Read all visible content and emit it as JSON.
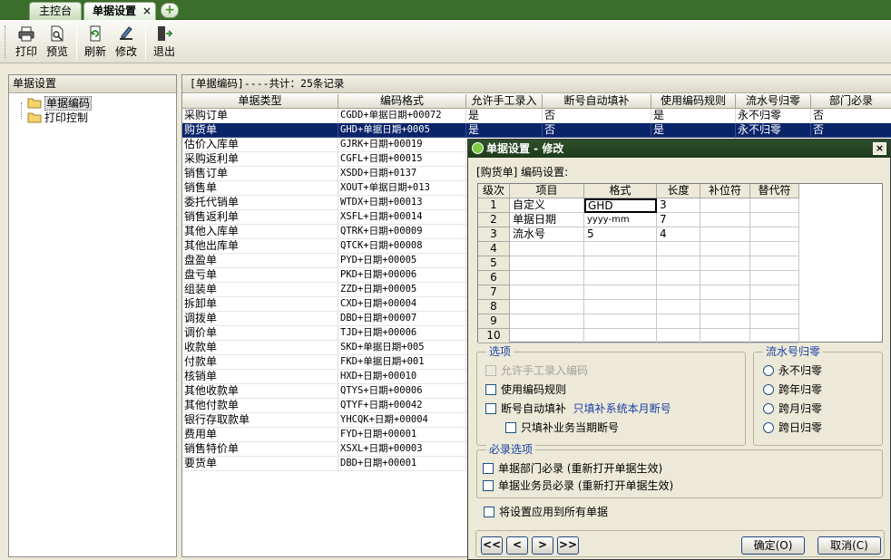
{
  "tabs": {
    "home": "主控台",
    "current": "单据设置",
    "close": "×",
    "add": "+"
  },
  "toolbar": {
    "print": "打印",
    "preview": "预览",
    "refresh": "刷新",
    "edit": "修改",
    "exit": "退出"
  },
  "left": {
    "title": "单据设置",
    "items": [
      {
        "label": "单据编码"
      },
      {
        "label": "打印控制"
      }
    ]
  },
  "main": {
    "title": "[单据编码]----共计：25条记录",
    "headers": [
      "单据类型",
      "编码格式",
      "允许手工录入",
      "断号自动填补",
      "使用编码规则",
      "流水号归零",
      "部门必录"
    ],
    "rows": [
      [
        "采购订单",
        "CGDD+单据日期+00072",
        "是",
        "否",
        "是",
        "永不归零",
        "否"
      ],
      [
        "购货单",
        "GHD+单据日期+0005",
        "是",
        "否",
        "是",
        "永不归零",
        "否"
      ],
      [
        "估价入库单",
        "GJRK+日期+00019",
        "",
        "",
        "",
        "",
        ""
      ],
      [
        "采购返利单",
        "CGFL+日期+00015",
        "",
        "",
        "",
        "",
        ""
      ],
      [
        "销售订单",
        "XSDD+日期+0137",
        "",
        "",
        "",
        "",
        ""
      ],
      [
        "销售单",
        "XOUT+单据日期+013",
        "",
        "",
        "",
        "",
        ""
      ],
      [
        "委托代销单",
        "WTDX+日期+00013",
        "",
        "",
        "",
        "",
        ""
      ],
      [
        "销售返利单",
        "XSFL+日期+00014",
        "",
        "",
        "",
        "",
        ""
      ],
      [
        "其他入库单",
        "QTRK+日期+00009",
        "",
        "",
        "",
        "",
        ""
      ],
      [
        "其他出库单",
        "QTCK+日期+00008",
        "",
        "",
        "",
        "",
        ""
      ],
      [
        "盘盈单",
        "PYD+日期+00005",
        "",
        "",
        "",
        "",
        ""
      ],
      [
        "盘亏单",
        "PKD+日期+00006",
        "",
        "",
        "",
        "",
        ""
      ],
      [
        "组装单",
        "ZZD+日期+00005",
        "",
        "",
        "",
        "",
        ""
      ],
      [
        "拆卸单",
        "CXD+日期+00004",
        "",
        "",
        "",
        "",
        ""
      ],
      [
        "调拨单",
        "DBD+日期+00007",
        "",
        "",
        "",
        "",
        ""
      ],
      [
        "调价单",
        "TJD+日期+00006",
        "",
        "",
        "",
        "",
        ""
      ],
      [
        "收款单",
        "SKD+单据日期+005",
        "",
        "",
        "",
        "",
        ""
      ],
      [
        "付款单",
        "FKD+单据日期+001",
        "",
        "",
        "",
        "",
        ""
      ],
      [
        "核销单",
        "HXD+日期+00010",
        "",
        "",
        "",
        "",
        ""
      ],
      [
        "其他收款单",
        "QTYS+日期+00006",
        "",
        "",
        "",
        "",
        ""
      ],
      [
        "其他付款单",
        "QTYF+日期+00042",
        "",
        "",
        "",
        "",
        ""
      ],
      [
        "银行存取款单",
        "YHCQK+日期+00004",
        "",
        "",
        "",
        "",
        ""
      ],
      [
        "费用单",
        "FYD+日期+00001",
        "",
        "",
        "",
        "",
        ""
      ],
      [
        "销售特价单",
        "XSXL+日期+00003",
        "",
        "",
        "",
        "",
        ""
      ],
      [
        "要货单",
        "DBD+日期+00001",
        "",
        "",
        "",
        "",
        ""
      ]
    ],
    "selected_row": 1
  },
  "dialog": {
    "title": "单据设置 - 修改",
    "close": "×",
    "subtitle": "[购货单] 编码设置:",
    "grid_headers": [
      "级次",
      "项目",
      "格式",
      "长度",
      "补位符",
      "替代符"
    ],
    "grid_rows": [
      [
        "1",
        "自定义",
        "GHD",
        "3",
        "",
        ""
      ],
      [
        "2",
        "单据日期",
        "yyyy-mm",
        "7",
        "",
        ""
      ],
      [
        "3",
        "流水号",
        "5",
        "4",
        "",
        ""
      ],
      [
        "4",
        "",
        "",
        "",
        "",
        ""
      ],
      [
        "5",
        "",
        "",
        "",
        "",
        ""
      ],
      [
        "6",
        "",
        "",
        "",
        "",
        ""
      ],
      [
        "7",
        "",
        "",
        "",
        "",
        ""
      ],
      [
        "8",
        "",
        "",
        "",
        "",
        ""
      ],
      [
        "9",
        "",
        "",
        "",
        "",
        ""
      ],
      [
        "10",
        "",
        "",
        "",
        "",
        ""
      ]
    ],
    "options": {
      "legend": "选项",
      "allow_manual": "允许手工录入编码",
      "use_rule": "使用编码规则",
      "auto_fill": "断号自动填补",
      "auto_fill_hint": "只填补系统本月断号",
      "business_only": "只填补业务当期断号"
    },
    "reset": {
      "legend": "流水号归零",
      "never": "永不归零",
      "yearly": "跨年归零",
      "monthly": "跨月归零",
      "daily": "跨日归零"
    },
    "required": {
      "legend": "必录选项",
      "dept": "单据部门必录 (重新打开单据生效)",
      "staff": "单据业务员必录 (重新打开单据生效)"
    },
    "apply_all": "将设置应用到所有单据",
    "nav": {
      "first": "<<",
      "prev": "<",
      "next": ">",
      "last": ">>"
    },
    "ok": "确定(O)",
    "cancel": "取消(C)"
  },
  "colors": {
    "tab_bar": "#3b6e2a",
    "selection": "#0a246a",
    "legend_text": "#1a3fa6",
    "dialog_title": "#2f4f2a"
  }
}
